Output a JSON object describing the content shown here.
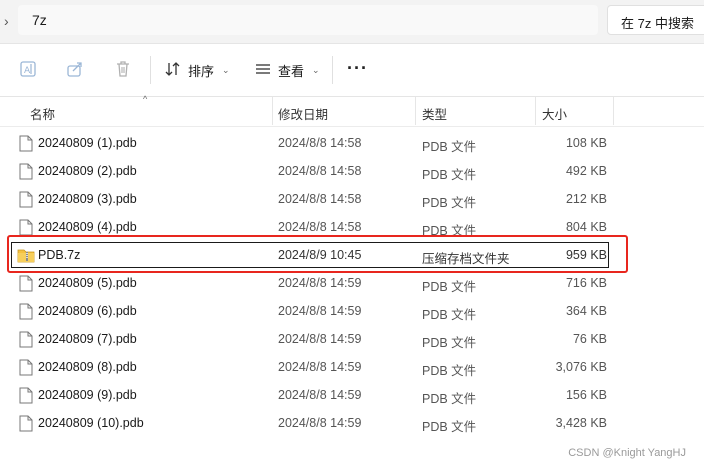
{
  "address": {
    "path": "7z"
  },
  "search": {
    "placeholder": "在 7z 中搜索"
  },
  "toolbar": {
    "sort_label": "排序",
    "view_label": "查看",
    "more_label": "···"
  },
  "columns": {
    "name": "名称",
    "date": "修改日期",
    "type": "类型",
    "size": "大小"
  },
  "files": [
    {
      "name": "20240809 (1).pdb",
      "date": "2024/8/8 14:58",
      "type": "PDB 文件",
      "size": "108 KB",
      "kind": "file"
    },
    {
      "name": "20240809 (2).pdb",
      "date": "2024/8/8 14:58",
      "type": "PDB 文件",
      "size": "492 KB",
      "kind": "file"
    },
    {
      "name": "20240809 (3).pdb",
      "date": "2024/8/8 14:58",
      "type": "PDB 文件",
      "size": "212 KB",
      "kind": "file"
    },
    {
      "name": "20240809 (4).pdb",
      "date": "2024/8/8 14:58",
      "type": "PDB 文件",
      "size": "804 KB",
      "kind": "file"
    },
    {
      "name": "PDB.7z",
      "date": "2024/8/9 10:45",
      "type": "压缩存档文件夹",
      "size": "959 KB",
      "kind": "zip-folder"
    },
    {
      "name": "20240809 (5).pdb",
      "date": "2024/8/8 14:59",
      "type": "PDB 文件",
      "size": "716 KB",
      "kind": "file"
    },
    {
      "name": "20240809 (6).pdb",
      "date": "2024/8/8 14:59",
      "type": "PDB 文件",
      "size": "364 KB",
      "kind": "file"
    },
    {
      "name": "20240809 (7).pdb",
      "date": "2024/8/8 14:59",
      "type": "PDB 文件",
      "size": "76 KB",
      "kind": "file"
    },
    {
      "name": "20240809 (8).pdb",
      "date": "2024/8/8 14:59",
      "type": "PDB 文件",
      "size": "3,076 KB",
      "kind": "file"
    },
    {
      "name": "20240809 (9).pdb",
      "date": "2024/8/8 14:59",
      "type": "PDB 文件",
      "size": "156 KB",
      "kind": "file"
    },
    {
      "name": "20240809 (10).pdb",
      "date": "2024/8/8 14:59",
      "type": "PDB 文件",
      "size": "3,428 KB",
      "kind": "file"
    }
  ],
  "watermark": "CSDN @Knight YangHJ",
  "colors": {
    "highlight_border": "#e8261e",
    "folder_yellow": "#f5c242",
    "accent": "#0067c0"
  }
}
